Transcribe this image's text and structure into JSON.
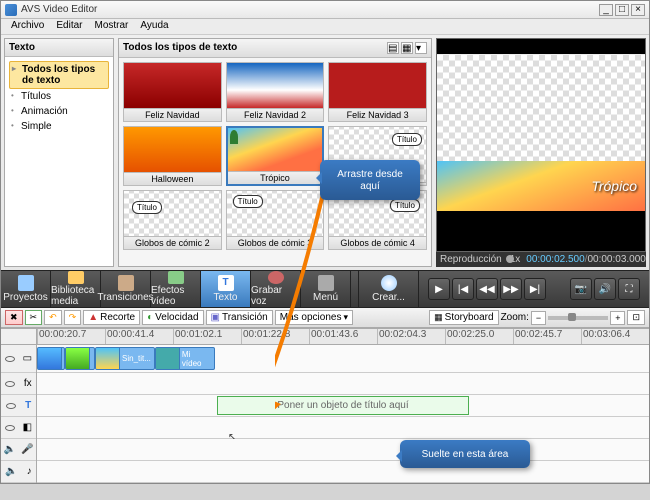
{
  "window": {
    "title": "AVS Video Editor"
  },
  "menu": {
    "archivo": "Archivo",
    "editar": "Editar",
    "mostrar": "Mostrar",
    "ayuda": "Ayuda"
  },
  "sidebar": {
    "header": "Texto",
    "items": [
      "Todos los tipos de texto",
      "Títulos",
      "Animación",
      "Simple"
    ]
  },
  "gallery": {
    "header": "Todos los tipos de texto",
    "thumbs": [
      {
        "label": "Feliz Navidad"
      },
      {
        "label": "Feliz Navidad 2"
      },
      {
        "label": "Feliz Navidad 3"
      },
      {
        "label": "Halloween"
      },
      {
        "label": "Trópico"
      },
      {
        "label": ""
      },
      {
        "label": "Globos de cómic 2"
      },
      {
        "label": "Globos de cómic 3"
      },
      {
        "label": "Globos de cómic 4"
      }
    ],
    "bubble_titulo": "Título"
  },
  "preview": {
    "label_repro": "Reproducción",
    "speed": "1x",
    "time_current": "00:00:02.500",
    "time_total": "00:00:03.000",
    "tropico": "Trópico"
  },
  "tools": {
    "proyectos": "Proyectos",
    "biblioteca": "Biblioteca media",
    "transiciones": "Transiciones",
    "efectos": "Efectos vídeo",
    "texto": "Texto",
    "grabar": "Grabar voz",
    "menu": "Menú",
    "crear": "Crear..."
  },
  "timeline_tools": {
    "recorte": "Recorte",
    "velocidad": "Velocidad",
    "transicion": "Transición",
    "mas": "Más opciones",
    "storyboard": "Storyboard",
    "zoom": "Zoom:"
  },
  "ruler": [
    "00:00:20.7",
    "00:00:41.4",
    "00:01:02.1",
    "00:01:22.8",
    "00:01:43.6",
    "00:02:04.3",
    "00:02:25.0",
    "00:02:45.7",
    "00:03:06.4"
  ],
  "clips": {
    "c1": "Sin_tit...",
    "c2": "Mi vídeo"
  },
  "drop_hint": "Poner un objeto de título aquí",
  "callouts": {
    "drag": "Arrastre desde aquí",
    "drop": "Suelte en esta área"
  }
}
